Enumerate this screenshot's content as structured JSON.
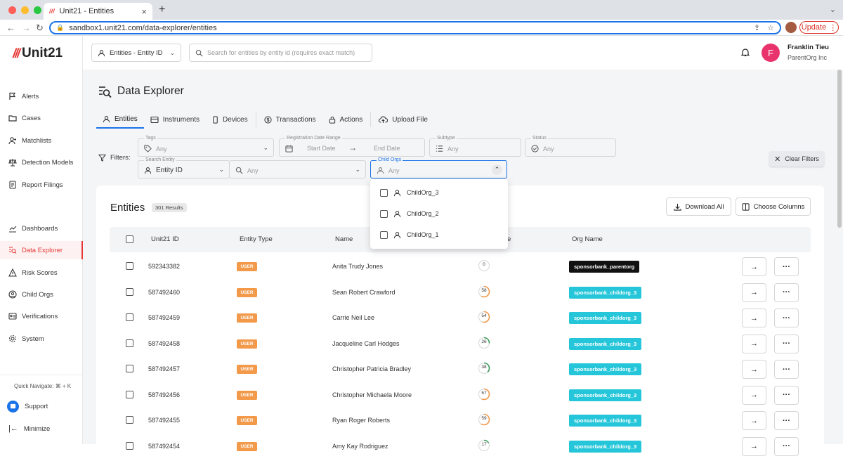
{
  "browser": {
    "tab_title": "Unit21 - Entities",
    "url": "sandbox1.unit21.com/data-explorer/entities",
    "update_label": "Update"
  },
  "sidebar": {
    "logo": "Unit21",
    "items": [
      {
        "label": "Alerts",
        "icon": "flag-icon"
      },
      {
        "label": "Cases",
        "icon": "folder-icon"
      },
      {
        "label": "Matchlists",
        "icon": "user-plus-icon"
      },
      {
        "label": "Detection Models",
        "icon": "scale-icon"
      },
      {
        "label": "Report Filings",
        "icon": "document-icon"
      },
      {
        "label": "Dashboards",
        "icon": "chart-icon"
      },
      {
        "label": "Data Explorer",
        "icon": "data-search-icon"
      },
      {
        "label": "Risk Scores",
        "icon": "warning-icon"
      },
      {
        "label": "Child Orgs",
        "icon": "org-icon"
      },
      {
        "label": "Verifications",
        "icon": "id-card-icon"
      },
      {
        "label": "System",
        "icon": "gear-icon"
      }
    ],
    "quick_navigate": "Quick Navigate: ⌘ + K",
    "support": "Support",
    "minimize": "Minimize"
  },
  "header": {
    "entity_select": "Entities - Entity ID",
    "search_placeholder": "Search for entities by entity id (requires exact match)",
    "user_initial": "F",
    "user_name": "Franklin Tieu",
    "user_org": "ParentOrg Inc"
  },
  "page": {
    "title": "Data Explorer",
    "tabs": [
      "Entities",
      "Instruments",
      "Devices",
      "Transactions",
      "Actions",
      "Upload File"
    ]
  },
  "filters": {
    "label": "Filters:",
    "tags": {
      "label": "Tags",
      "value": "Any"
    },
    "registration": {
      "label": "Registration Date Range",
      "start": "Start Date",
      "end": "End Date"
    },
    "subtype": {
      "label": "Subtype",
      "value": "Any"
    },
    "status": {
      "label": "Status",
      "value": "Any"
    },
    "search_entity": {
      "label": "Search Entity",
      "value": "Entity ID"
    },
    "search_value": "Any",
    "child_orgs": {
      "label": "Child Orgs",
      "value": "Any",
      "options": [
        "ChildOrg_3",
        "ChildOrg_2",
        "ChildOrg_1"
      ]
    },
    "clear": "Clear Filters"
  },
  "card": {
    "title": "Entities",
    "results": "301 Results",
    "download": "Download All",
    "choose_columns": "Choose Columns",
    "columns": [
      "Unit21 ID",
      "Entity Type",
      "Name",
      "e",
      "Org Name"
    ],
    "rows": [
      {
        "id": "592343382",
        "type": "USER",
        "name": "Anita Trudy Jones",
        "score": "0",
        "org": "sponsorbank_parentorg"
      },
      {
        "id": "587492460",
        "type": "USER",
        "name": "Sean Robert Crawford",
        "score": "58",
        "org": "sponsorbank_childorg_3"
      },
      {
        "id": "587492459",
        "type": "USER",
        "name": "Carrie Neil Lee",
        "score": "54",
        "org": "sponsorbank_childorg_3"
      },
      {
        "id": "587492458",
        "type": "USER",
        "name": "Jacqueline Carl Hodges",
        "score": "26",
        "org": "sponsorbank_childorg_3"
      },
      {
        "id": "587492457",
        "type": "USER",
        "name": "Christopher Patricia Bradley",
        "score": "38",
        "org": "sponsorbank_childorg_3"
      },
      {
        "id": "587492456",
        "type": "USER",
        "name": "Christopher Michaela Moore",
        "score": "57",
        "org": "sponsorbank_childorg_3"
      },
      {
        "id": "587492455",
        "type": "USER",
        "name": "Ryan Roger Roberts",
        "score": "59",
        "org": "sponsorbank_childorg_3"
      },
      {
        "id": "587492454",
        "type": "USER",
        "name": "Amy Kay Rodriguez",
        "score": "17",
        "org": "sponsorbank_childorg_3"
      }
    ]
  },
  "colors": {
    "accent": "#1a73e8",
    "brand": "#e53935",
    "user_badge": "#f2994a",
    "org_child": "#26c6da",
    "org_parent": "#111111"
  }
}
